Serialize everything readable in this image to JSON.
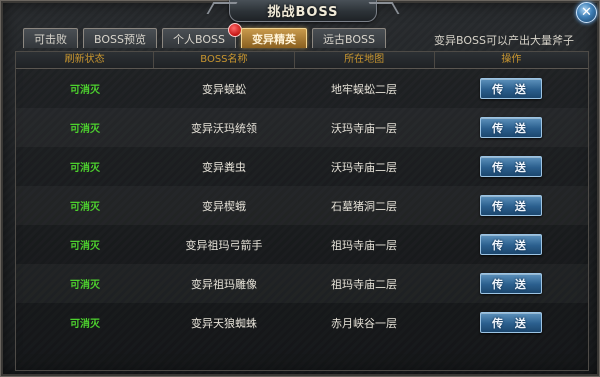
{
  "window": {
    "title": "挑战BOSS",
    "close_label": "✕"
  },
  "tabs": [
    {
      "label": "可击败",
      "active": false,
      "badge": false
    },
    {
      "label": "BOSS预览",
      "active": false,
      "badge": false
    },
    {
      "label": "个人BOSS",
      "active": false,
      "badge": true
    },
    {
      "label": "变异精英",
      "active": true,
      "badge": false
    },
    {
      "label": "远古BOSS",
      "active": false,
      "badge": false
    }
  ],
  "hint": "变异BOSS可以产出大量斧子",
  "table": {
    "columns": [
      "刷新状态",
      "BOSS名称",
      "所在地图",
      "操作"
    ],
    "rows": [
      {
        "status": "可消灭",
        "name": "变异蜈蚣",
        "map": "地牢蜈蚣二层",
        "action": "传 送"
      },
      {
        "status": "可消灭",
        "name": "变异沃玛统领",
        "map": "沃玛寺庙一层",
        "action": "传 送"
      },
      {
        "status": "可消灭",
        "name": "变异粪虫",
        "map": "沃玛寺庙二层",
        "action": "传 送"
      },
      {
        "status": "可消灭",
        "name": "变异楔蛾",
        "map": "石墓猪洞二层",
        "action": "传 送"
      },
      {
        "status": "可消灭",
        "name": "变异祖玛弓箭手",
        "map": "祖玛寺庙一层",
        "action": "传 送"
      },
      {
        "status": "可消灭",
        "name": "变异祖玛雕像",
        "map": "祖玛寺庙二层",
        "action": "传 送"
      },
      {
        "status": "可消灭",
        "name": "变异天狼蜘蛛",
        "map": "赤月峡谷一层",
        "action": "传 送"
      }
    ]
  },
  "colors": {
    "status_green": "#4dd22e",
    "header_gold": "#c9962f",
    "active_tab": "#c89a4c",
    "button_blue": "#2b5f8e",
    "badge_red": "#c21010"
  }
}
